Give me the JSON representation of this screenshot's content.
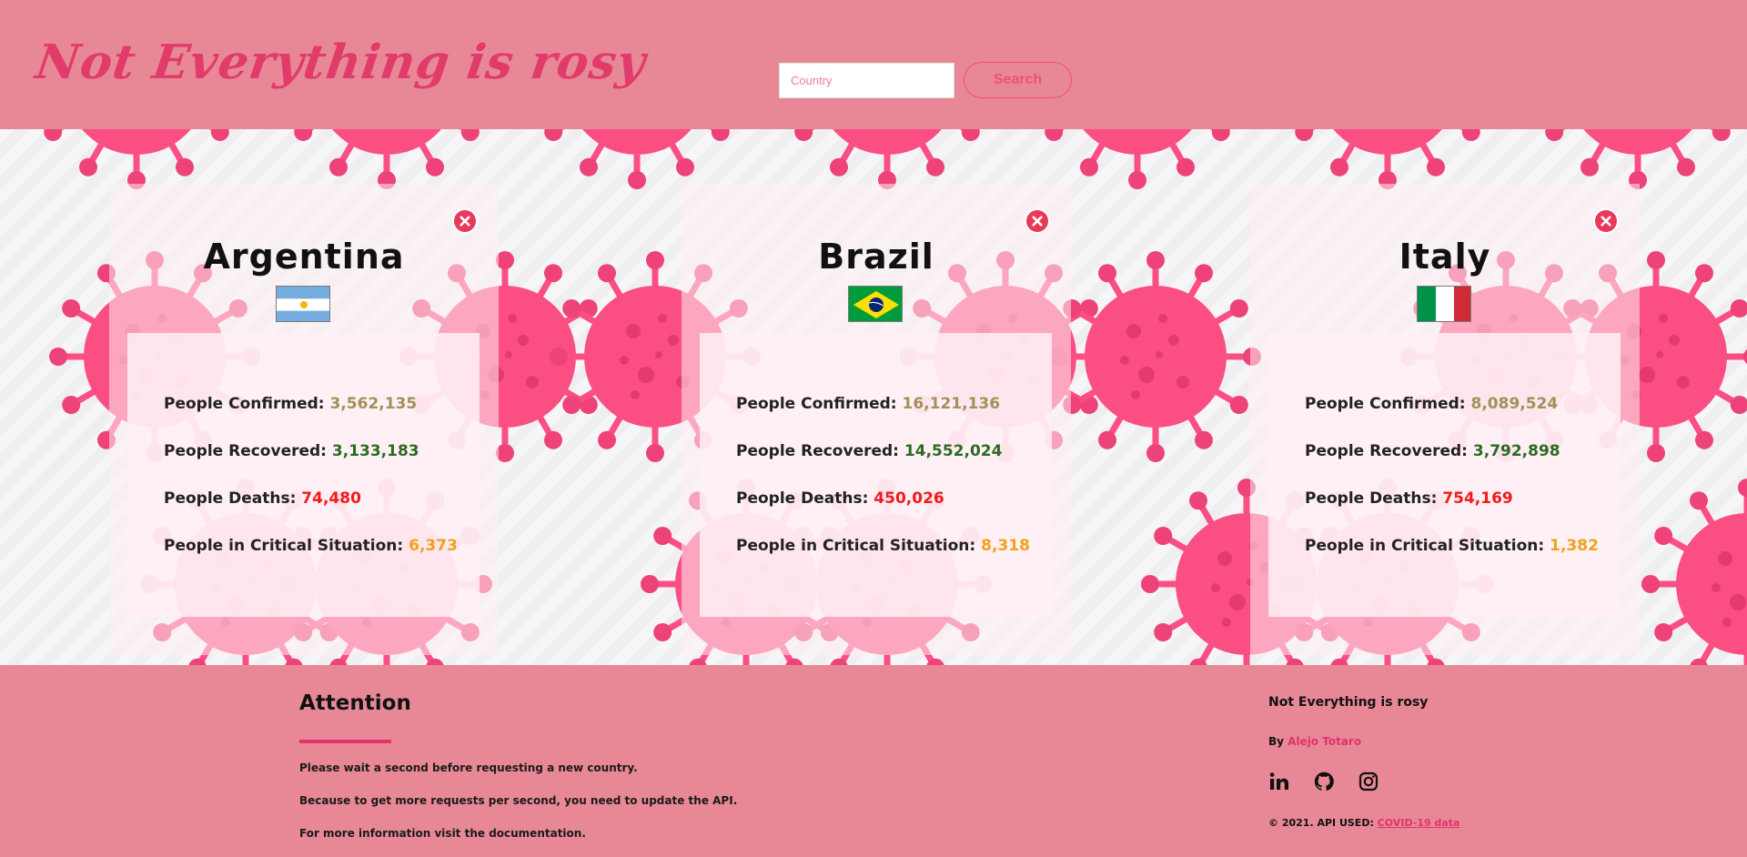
{
  "header": {
    "brand": "Not Everything is rosy",
    "search_placeholder": "Country",
    "search_label": "Search"
  },
  "cards": [
    {
      "country": "Argentina",
      "flag": "argentina-flag",
      "confirmed_label": "People Confirmed:",
      "confirmed": "3,562,135",
      "recovered_label": "People Recovered:",
      "recovered": "3,133,183",
      "deaths_label": "People Deaths:",
      "deaths": "74,480",
      "critical_label": "People in Critical Situation:",
      "critical": "6,373"
    },
    {
      "country": "Brazil",
      "flag": "brazil-flag",
      "confirmed_label": "People Confirmed:",
      "confirmed": "16,121,136",
      "recovered_label": "People Recovered:",
      "recovered": "14,552,024",
      "deaths_label": "People Deaths:",
      "deaths": "450,026",
      "critical_label": "People in Critical Situation:",
      "critical": "8,318"
    },
    {
      "country": "Italy",
      "flag": "italy-flag",
      "confirmed_label": "People Confirmed:",
      "confirmed": "8,089,524",
      "recovered_label": "People Recovered:",
      "recovered": "3,792,898",
      "deaths_label": "People Deaths:",
      "deaths": "754,169",
      "critical_label": "People in Critical Situation:",
      "critical": "1,382"
    }
  ],
  "footer": {
    "attention_title": "Attention",
    "attention_lines": [
      "Please wait a second before requesting a new country.",
      "Because to get more requests per second, you need to update the API.",
      "For more information visit the documentation."
    ],
    "site_title": "Not Everything is rosy",
    "by_label": "By",
    "author": "Alejo Totaro",
    "copyright": "© 2021. API USED:",
    "api_link": "COVID-19 data",
    "social_icons": [
      "linkedin-icon",
      "github-icon",
      "instagram-icon"
    ]
  },
  "colors": {
    "header_bg": "#e88896",
    "brand": "#e13b6b",
    "virus": "#fb4f84",
    "confirmed": "#a09257",
    "recovered": "#2b6b22",
    "deaths": "#f21a1a",
    "critical": "#f0a21a"
  }
}
